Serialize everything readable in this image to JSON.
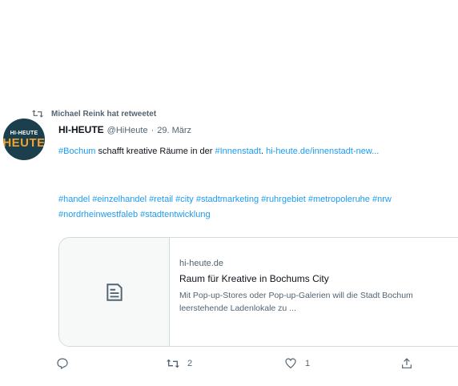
{
  "retweet": {
    "text": "Michael Reink hat retweetet",
    "icon": "retweet-icon"
  },
  "tweet": {
    "avatar": {
      "top_text": "HI-HEUTE",
      "main_text": "HEUTE"
    },
    "author_name": "HI-HEUTE",
    "author_handle": "@HiHeute",
    "separator": "·",
    "date": "29. März",
    "body": {
      "hashtag_bochum": "#Bochum",
      "text_middle": " schafft kreative Räume in der ",
      "hashtag_innenstadt": "#Innenstadt",
      "text_after": ". ",
      "link": "hi-heute.de/innenstadt-new..."
    },
    "hashtags": "#handel #einzelhandel #retail #city #stadtmarketing #ruhrgebiet #metropoleruhe #nrw #nordrheinwestfaleb #stadtentwicklung",
    "card": {
      "domain": "hi-heute.de",
      "title": "Raum für Kreative in Bochums City",
      "description": "Mit Pop-up-Stores oder Pop-up-Galerien will die Stadt Bochum leerstehende Ladenlokale zu ..."
    },
    "actions": {
      "reply_count": "",
      "retweet_count": "2",
      "like_count": "1"
    }
  },
  "colors": {
    "accent": "#1d9bf0",
    "muted": "#536471",
    "text": "#0f1419",
    "border": "#cfd9de"
  }
}
